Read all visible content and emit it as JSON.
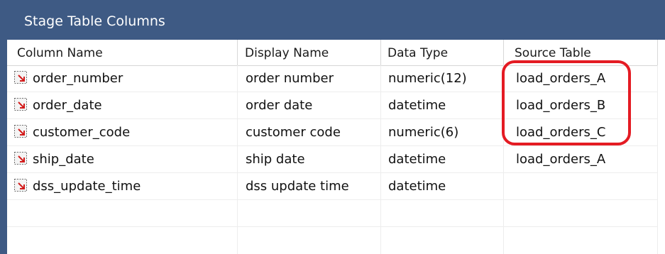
{
  "panel": {
    "title": "Stage Table Columns"
  },
  "columns": [
    {
      "label": "Column Name"
    },
    {
      "label": "Display Name"
    },
    {
      "label": "Data Type"
    },
    {
      "label": "Source Table"
    }
  ],
  "rows": [
    {
      "column_name": "order_number",
      "display_name": "order number",
      "data_type": "numeric(12)",
      "source_table": "load_orders_A"
    },
    {
      "column_name": "order_date",
      "display_name": "order date",
      "data_type": "datetime",
      "source_table": "load_orders_B"
    },
    {
      "column_name": "customer_code",
      "display_name": "customer code",
      "data_type": "numeric(6)",
      "source_table": "load_orders_C"
    },
    {
      "column_name": "ship_date",
      "display_name": "ship date",
      "data_type": "datetime",
      "source_table": "load_orders_A"
    },
    {
      "column_name": "dss_update_time",
      "display_name": "dss update time",
      "data_type": "datetime",
      "source_table": ""
    }
  ],
  "row_icon": "column-arrow-icon",
  "colors": {
    "title_bar": "#3e5a84",
    "highlight": "#e41b23"
  },
  "annotation": {
    "highlighted_rows": [
      0,
      1,
      2
    ],
    "highlighted_column": "Source Table"
  }
}
